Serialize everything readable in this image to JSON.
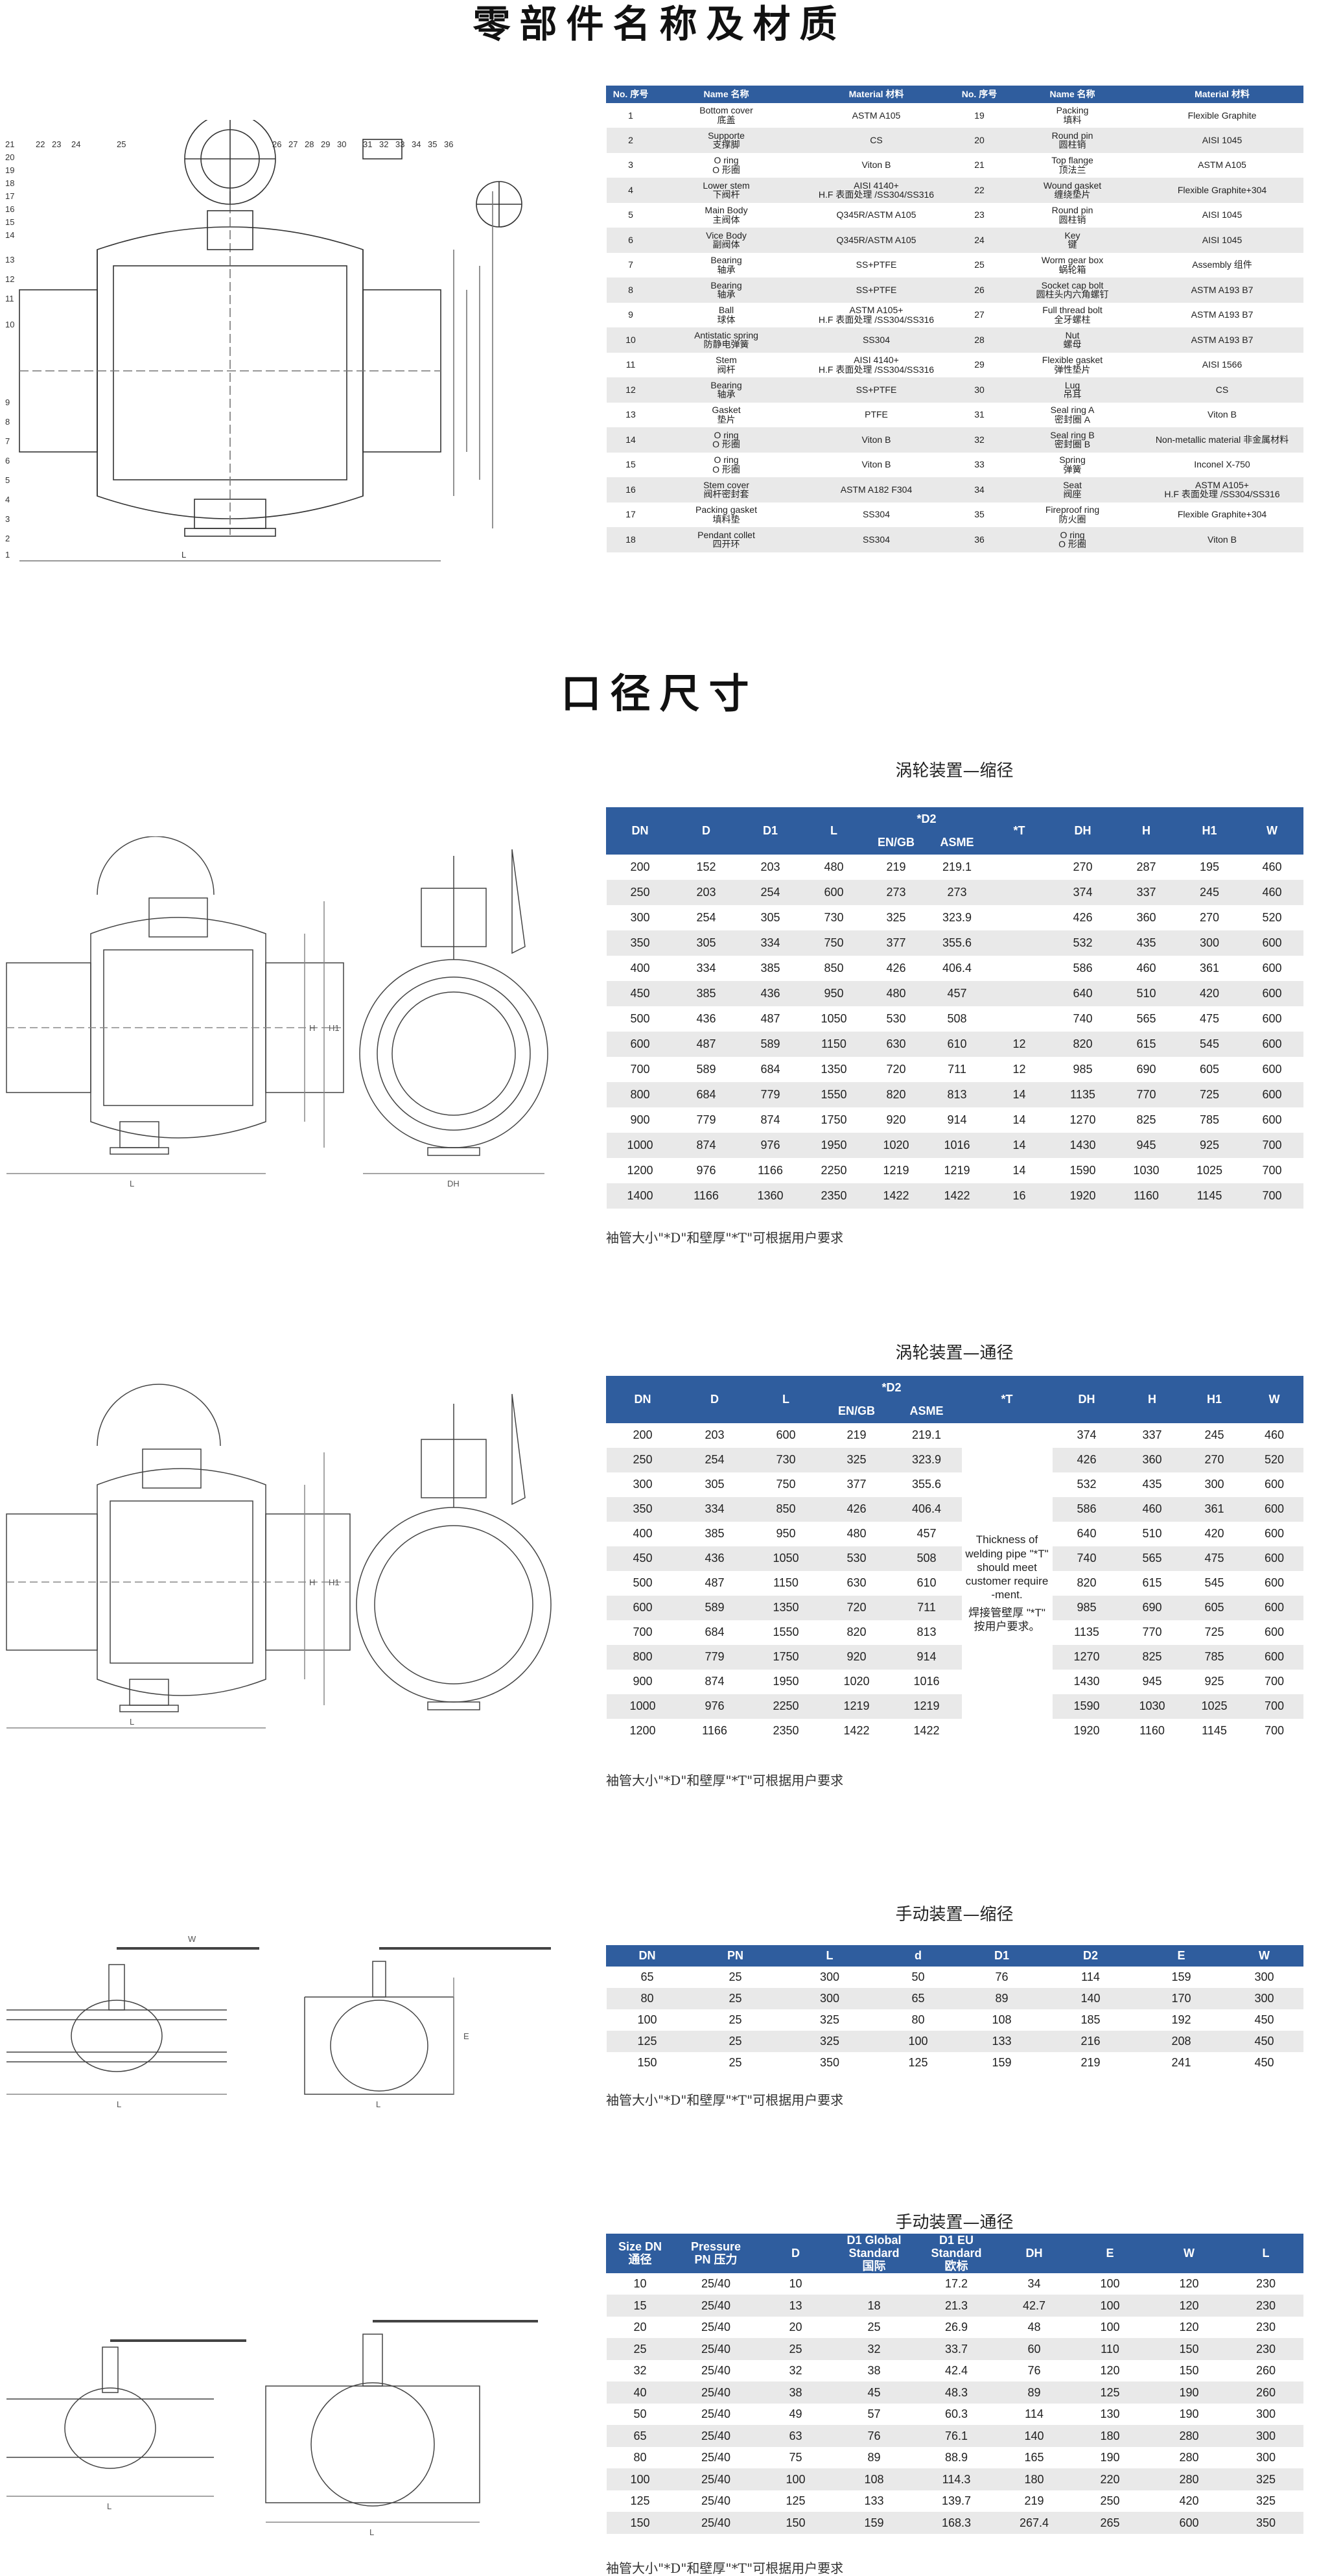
{
  "titles": {
    "parts": "零部件名称及材质",
    "dims": "口径尺寸"
  },
  "parts_table": {
    "headers": [
      "No. 序号",
      "Name 名称",
      "Material 材料",
      "No. 序号",
      "Name 名称",
      "Material 材料"
    ],
    "rows": [
      [
        "1",
        "Bottom cover",
        "底盖",
        "ASTM A105",
        "19",
        "Packing",
        "填料",
        "Flexible Graphite",
        ""
      ],
      [
        "2",
        "Supporte",
        "支撑脚",
        "CS",
        "20",
        "Round pin",
        "圆柱销",
        "AISI 1045",
        ""
      ],
      [
        "3",
        "O ring",
        "O 形圈",
        "Viton B",
        "21",
        "Top flange",
        "顶法兰",
        "ASTM A105",
        ""
      ],
      [
        "4",
        "Lower stem",
        "下阀杆",
        "AISI 4140+",
        "22",
        "Wound gasket",
        "缠绕垫片",
        "Flexible Graphite+304",
        "H.F 表面处理 /SS304/SS316"
      ],
      [
        "5",
        "Main Body",
        "主阀体",
        "Q345R/ASTM A105",
        "23",
        "Round pin",
        "圆柱销",
        "AISI 1045",
        ""
      ],
      [
        "6",
        "Vice Body",
        "副阀体",
        "Q345R/ASTM A105",
        "24",
        "Key",
        "键",
        "AISI 1045",
        ""
      ],
      [
        "7",
        "Bearing",
        "轴承",
        "SS+PTFE",
        "25",
        "Worm gear box",
        "蜗轮箱",
        "Assembly 组件",
        ""
      ],
      [
        "8",
        "Bearing",
        "轴承",
        "SS+PTFE",
        "26",
        "Socket cap bolt",
        "圆柱头内六角螺钉",
        "ASTM A193 B7",
        ""
      ],
      [
        "9",
        "Ball",
        "球体",
        "ASTM A105+",
        "27",
        "Full thread bolt",
        "全牙螺柱",
        "ASTM A193 B7",
        "H.F 表面处理 /SS304/SS316"
      ],
      [
        "10",
        "Antistatic spring",
        "防静电弹簧",
        "SS304",
        "28",
        "Nut",
        "螺母",
        "ASTM A193 B7",
        ""
      ],
      [
        "11",
        "Stem",
        "阀杆",
        "AISI 4140+",
        "29",
        "Flexible gasket",
        "弹性垫片",
        "AISI 1566",
        "H.F 表面处理 /SS304/SS316"
      ],
      [
        "12",
        "Bearing",
        "轴承",
        "SS+PTFE",
        "30",
        "Lug",
        "吊耳",
        "CS",
        ""
      ],
      [
        "13",
        "Gasket",
        "垫片",
        "PTFE",
        "31",
        "Seal ring A",
        "密封圈 A",
        "Viton B",
        ""
      ],
      [
        "14",
        "O ring",
        "O 形圈",
        "Viton B",
        "32",
        "Seal ring B",
        "密封圈 B",
        "Non-metallic material 非金属材料",
        ""
      ],
      [
        "15",
        "O ring",
        "O 形圈",
        "Viton B",
        "33",
        "Spring",
        "弹簧",
        "Inconel X-750",
        ""
      ],
      [
        "16",
        "Stem cover",
        "阀杆密封套",
        "ASTM A182 F304",
        "34",
        "Seat",
        "阀座",
        "ASTM A105+",
        "H.F 表面处理 /SS304/SS316"
      ],
      [
        "17",
        "Packing gasket",
        "填料垫",
        "SS304",
        "35",
        "Fireproof ring",
        "防火圈",
        "Flexible Graphite+304",
        ""
      ],
      [
        "18",
        "Pendant collet",
        "四开环",
        "SS304",
        "36",
        "O ring",
        "O 形圈",
        "Viton B",
        ""
      ]
    ]
  },
  "table1": {
    "title": "涡轮装置—缩径",
    "d2_label": "*D2",
    "headers": [
      "DN",
      "D",
      "D1",
      "L",
      "EN/GB",
      "ASME",
      "*T",
      "DH",
      "H",
      "H1",
      "W"
    ],
    "rows": [
      [
        "200",
        "152",
        "203",
        "480",
        "219",
        "219.1",
        "",
        "270",
        "287",
        "195",
        "460"
      ],
      [
        "250",
        "203",
        "254",
        "600",
        "273",
        "273",
        "",
        "374",
        "337",
        "245",
        "460"
      ],
      [
        "300",
        "254",
        "305",
        "730",
        "325",
        "323.9",
        "",
        "426",
        "360",
        "270",
        "520"
      ],
      [
        "350",
        "305",
        "334",
        "750",
        "377",
        "355.6",
        "",
        "532",
        "435",
        "300",
        "600"
      ],
      [
        "400",
        "334",
        "385",
        "850",
        "426",
        "406.4",
        "",
        "586",
        "460",
        "361",
        "600"
      ],
      [
        "450",
        "385",
        "436",
        "950",
        "480",
        "457",
        "",
        "640",
        "510",
        "420",
        "600"
      ],
      [
        "500",
        "436",
        "487",
        "1050",
        "530",
        "508",
        "",
        "740",
        "565",
        "475",
        "600"
      ],
      [
        "600",
        "487",
        "589",
        "1150",
        "630",
        "610",
        "12",
        "820",
        "615",
        "545",
        "600"
      ],
      [
        "700",
        "589",
        "684",
        "1350",
        "720",
        "711",
        "12",
        "985",
        "690",
        "605",
        "600"
      ],
      [
        "800",
        "684",
        "779",
        "1550",
        "820",
        "813",
        "14",
        "1135",
        "770",
        "725",
        "600"
      ],
      [
        "900",
        "779",
        "874",
        "1750",
        "920",
        "914",
        "14",
        "1270",
        "825",
        "785",
        "600"
      ],
      [
        "1000",
        "874",
        "976",
        "1950",
        "1020",
        "1016",
        "14",
        "1430",
        "945",
        "925",
        "700"
      ],
      [
        "1200",
        "976",
        "1166",
        "2250",
        "1219",
        "1219",
        "14",
        "1590",
        "1030",
        "1025",
        "700"
      ],
      [
        "1400",
        "1166",
        "1360",
        "2350",
        "1422",
        "1422",
        "16",
        "1920",
        "1160",
        "1145",
        "700"
      ]
    ],
    "note": "袖管大小\"*D\"和壁厚\"*T\"可根据用户要求"
  },
  "table2": {
    "title": "涡轮装置—通径",
    "d2_label": "*D2",
    "headers": [
      "DN",
      "D",
      "L",
      "EN/GB",
      "ASME",
      "*T",
      "DH",
      "H",
      "H1",
      "W"
    ],
    "t_note_en": "Thickness of welding pipe \"*T\" should meet customer require -ment.",
    "t_note_cn": "焊接管壁厚 \"*T\" 按用户要求。",
    "rows": [
      [
        "200",
        "203",
        "600",
        "219",
        "219.1",
        "374",
        "337",
        "245",
        "460"
      ],
      [
        "250",
        "254",
        "730",
        "325",
        "323.9",
        "426",
        "360",
        "270",
        "520"
      ],
      [
        "300",
        "305",
        "750",
        "377",
        "355.6",
        "532",
        "435",
        "300",
        "600"
      ],
      [
        "350",
        "334",
        "850",
        "426",
        "406.4",
        "586",
        "460",
        "361",
        "600"
      ],
      [
        "400",
        "385",
        "950",
        "480",
        "457",
        "640",
        "510",
        "420",
        "600"
      ],
      [
        "450",
        "436",
        "1050",
        "530",
        "508",
        "740",
        "565",
        "475",
        "600"
      ],
      [
        "500",
        "487",
        "1150",
        "630",
        "610",
        "820",
        "615",
        "545",
        "600"
      ],
      [
        "600",
        "589",
        "1350",
        "720",
        "711",
        "985",
        "690",
        "605",
        "600"
      ],
      [
        "700",
        "684",
        "1550",
        "820",
        "813",
        "1135",
        "770",
        "725",
        "600"
      ],
      [
        "800",
        "779",
        "1750",
        "920",
        "914",
        "1270",
        "825",
        "785",
        "600"
      ],
      [
        "900",
        "874",
        "1950",
        "1020",
        "1016",
        "1430",
        "945",
        "925",
        "700"
      ],
      [
        "1000",
        "976",
        "2250",
        "1219",
        "1219",
        "1590",
        "1030",
        "1025",
        "700"
      ],
      [
        "1200",
        "1166",
        "2350",
        "1422",
        "1422",
        "1920",
        "1160",
        "1145",
        "700"
      ]
    ],
    "note": "袖管大小\"*D\"和壁厚\"*T\"可根据用户要求"
  },
  "table3": {
    "title": "手动装置—缩径",
    "headers": [
      "DN",
      "PN",
      "L",
      "d",
      "D1",
      "D2",
      "E",
      "W"
    ],
    "rows": [
      [
        "65",
        "25",
        "300",
        "50",
        "76",
        "114",
        "159",
        "300"
      ],
      [
        "80",
        "25",
        "300",
        "65",
        "89",
        "140",
        "170",
        "300"
      ],
      [
        "100",
        "25",
        "325",
        "80",
        "108",
        "185",
        "192",
        "450"
      ],
      [
        "125",
        "25",
        "325",
        "100",
        "133",
        "216",
        "208",
        "450"
      ],
      [
        "150",
        "25",
        "350",
        "125",
        "159",
        "219",
        "241",
        "450"
      ]
    ],
    "note": "袖管大小\"*D\"和壁厚\"*T\"可根据用户要求"
  },
  "table4": {
    "title": "手动装置—通径",
    "headers": [
      [
        "Size DN",
        "通径"
      ],
      [
        "Pressure",
        "PN 压力"
      ],
      [
        "D",
        ""
      ],
      [
        "D1 Global",
        "Standard",
        "国际"
      ],
      [
        "D1 EU",
        "Standard",
        "欧标"
      ],
      [
        "DH",
        ""
      ],
      [
        "E",
        ""
      ],
      [
        "W",
        ""
      ],
      [
        "L",
        ""
      ]
    ],
    "rows": [
      [
        "10",
        "25/40",
        "10",
        "",
        "17.2",
        "34",
        "100",
        "120",
        "230"
      ],
      [
        "15",
        "25/40",
        "13",
        "18",
        "21.3",
        "42.7",
        "100",
        "120",
        "230"
      ],
      [
        "20",
        "25/40",
        "20",
        "25",
        "26.9",
        "48",
        "100",
        "120",
        "230"
      ],
      [
        "25",
        "25/40",
        "25",
        "32",
        "33.7",
        "60",
        "110",
        "150",
        "230"
      ],
      [
        "32",
        "25/40",
        "32",
        "38",
        "42.4",
        "76",
        "120",
        "150",
        "260"
      ],
      [
        "40",
        "25/40",
        "38",
        "45",
        "48.3",
        "89",
        "125",
        "190",
        "260"
      ],
      [
        "50",
        "25/40",
        "49",
        "57",
        "60.3",
        "114",
        "130",
        "190",
        "300"
      ],
      [
        "65",
        "25/40",
        "63",
        "76",
        "76.1",
        "140",
        "180",
        "280",
        "300"
      ],
      [
        "80",
        "25/40",
        "75",
        "89",
        "88.9",
        "165",
        "190",
        "280",
        "300"
      ],
      [
        "100",
        "25/40",
        "100",
        "108",
        "114.3",
        "180",
        "220",
        "280",
        "325"
      ],
      [
        "125",
        "25/40",
        "125",
        "133",
        "139.7",
        "219",
        "250",
        "420",
        "325"
      ],
      [
        "150",
        "25/40",
        "150",
        "159",
        "168.3",
        "267.4",
        "265",
        "600",
        "350"
      ]
    ],
    "note": "袖管大小\"*D\"和壁厚\"*T\"可根据用户要求"
  },
  "colors": {
    "header_blue": "#2f5d9e",
    "row_gray": "#e9e9e9"
  }
}
